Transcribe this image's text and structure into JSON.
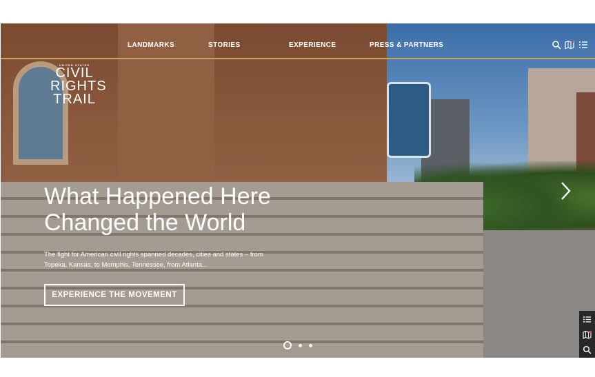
{
  "nav": {
    "links": [
      "LANDMARKS",
      "STORIES",
      "EXPERIENCE",
      "PRESS & PARTNERS"
    ],
    "icons": [
      "search-icon",
      "map-icon",
      "list-icon"
    ]
  },
  "logo": {
    "small": "UNITED STATES",
    "line1": "CIVIL",
    "line2": "RIGHTS",
    "line3": "TRAIL"
  },
  "hero": {
    "headline_line1": "What Happened Here",
    "headline_line2": "Changed the World",
    "subtext": "The fight for American civil rights spanned decades, cities and states – from Topeka, Kansas, to Memphis, Tennessee, from Atlanta...",
    "cta_label": "EXPERIENCE THE MOVEMENT",
    "slides_total": 3,
    "active_slide": 1
  },
  "side_tools": [
    "list-icon",
    "map-icon",
    "search-icon"
  ],
  "colors": {
    "accent_rule": "#c9a45a",
    "text": "#ffffff"
  }
}
